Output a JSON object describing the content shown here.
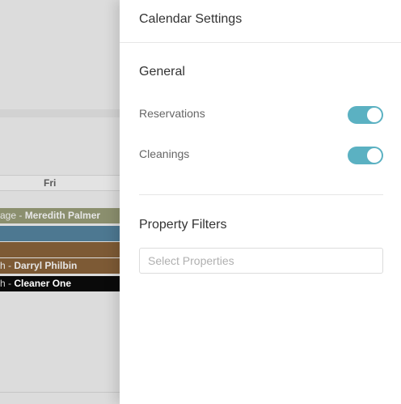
{
  "calendar": {
    "day_header": "Fri",
    "events": [
      {
        "prefix": "age - ",
        "name": "Meredith Palmer",
        "color": "#8b8f6e"
      },
      {
        "prefix": "",
        "name": "",
        "color": "#4d7891"
      },
      {
        "prefix": "",
        "name": "",
        "color": "#7d5a35"
      },
      {
        "prefix": "h - ",
        "name": "Darryl Philbin",
        "color": "#7d5a35"
      },
      {
        "prefix": "h - ",
        "name": "Cleaner One",
        "color": "#0a0a0a"
      }
    ]
  },
  "settings": {
    "title": "Calendar Settings",
    "general": {
      "title": "General",
      "reservations": {
        "label": "Reservations",
        "enabled": true
      },
      "cleanings": {
        "label": "Cleanings",
        "enabled": true
      }
    },
    "property_filters": {
      "title": "Property Filters",
      "select_placeholder": "Select Properties"
    }
  },
  "colors": {
    "toggle_on": "#5bb1c2"
  }
}
